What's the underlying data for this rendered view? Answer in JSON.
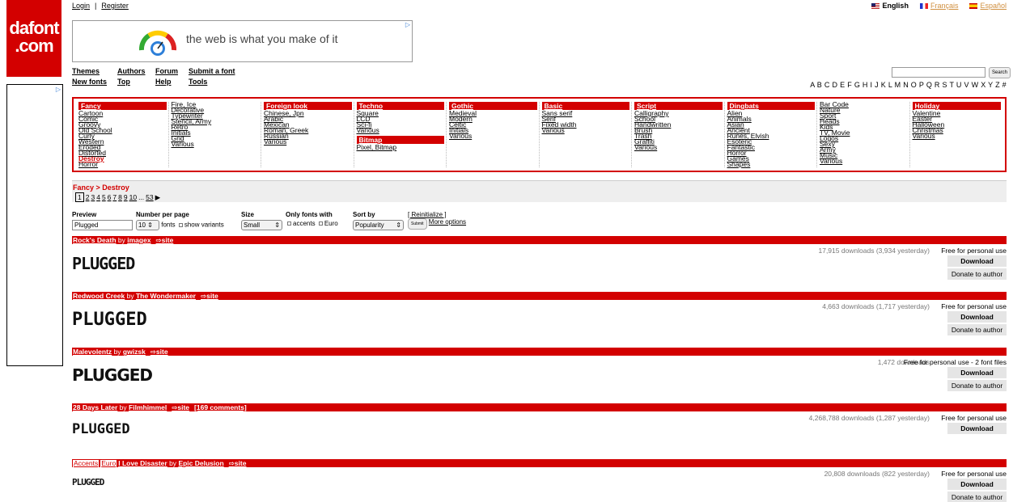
{
  "logo": {
    "line1": "dafont",
    "line2": ".com"
  },
  "top_links": {
    "login": "Login",
    "register": "Register"
  },
  "languages": {
    "english": "English",
    "french": "Français",
    "spanish": "Español"
  },
  "banner_ad": {
    "tagline": "the web is what you make of it"
  },
  "nav": {
    "themes": "Themes",
    "authors": "Authors",
    "forum": "Forum",
    "submit": "Submit a font",
    "new_fonts": "New fonts",
    "top": "Top",
    "help": "Help",
    "tools": "Tools"
  },
  "search": {
    "button": "Search",
    "value": ""
  },
  "alphabet": "A B C D E F G H I J K L M N O P Q R S T U V W X Y Z #",
  "categories": [
    {
      "head": "Fancy",
      "items": [
        "Cartoon",
        "Comic",
        "Groovy",
        "Old School",
        "Curly",
        "Western",
        "Eroded",
        "Distorted",
        "Destroy",
        "Horror"
      ],
      "active": "Destroy"
    },
    {
      "head": "",
      "items": [
        "Fire, Ice",
        "Decorative",
        "Typewriter",
        "Stencil, Army",
        "Retro",
        "Initials",
        "Grid",
        "Various"
      ]
    },
    {
      "head": "Foreign look",
      "items": [
        "Chinese, Jpn",
        "Arabic",
        "Mexican",
        "Roman, Greek",
        "Russian",
        "Various"
      ]
    },
    {
      "head": "Techno",
      "items": [
        "Square",
        "LCD",
        "Sci-fi",
        "Various"
      ],
      "head2": "Bitmap",
      "items2": [
        "Pixel, Bitmap"
      ]
    },
    {
      "head": "Gothic",
      "items": [
        "Medieval",
        "Modern",
        "Celtic",
        "Initials",
        "Various"
      ]
    },
    {
      "head": "Basic",
      "items": [
        "Sans serif",
        "Serif",
        "Fixed width",
        "Various"
      ]
    },
    {
      "head": "Script",
      "items": [
        "Calligraphy",
        "School",
        "Handwritten",
        "Brush",
        "Trash",
        "Graffiti",
        "Various"
      ]
    },
    {
      "head": "Dingbats",
      "items": [
        "Alien",
        "Animals",
        "Asian",
        "Ancient",
        "Runes, Elvish",
        "Esoteric",
        "Fantastic",
        "Horror",
        "Games",
        "Shapes"
      ]
    },
    {
      "head": "",
      "items": [
        "Bar Code",
        "Nature",
        "Sport",
        "Heads",
        "Kids",
        "TV, Movie",
        "Logos",
        "Sexy",
        "Army",
        "Music",
        "Various"
      ]
    },
    {
      "head": "Holiday",
      "items": [
        "Valentine",
        "Easter",
        "Halloween",
        "Christmas",
        "Various"
      ]
    }
  ],
  "breadcrumb": "Fancy > Destroy",
  "pagination": {
    "current": "1",
    "pages": [
      "2",
      "3",
      "4",
      "5",
      "6",
      "7",
      "8",
      "9",
      "10"
    ],
    "ellipsis": "...",
    "last": "53",
    "next": "▶"
  },
  "options": {
    "preview_label": "Preview",
    "preview_value": "Plugged",
    "number_label": "Number per page",
    "number_value": "10",
    "fonts_text": "fonts",
    "show_variants": "show variants",
    "size_label": "Size",
    "size_value": "Small",
    "only_label": "Only fonts with",
    "accents": "accents",
    "euro": "Euro",
    "sort_label": "Sort by",
    "sort_value": "Popularity",
    "reinit": "[ Reinitialize ]",
    "submit": "Submit",
    "more": "More options"
  },
  "fonts": [
    {
      "name": "Rock's Death",
      "by": "by",
      "author": "imagex",
      "site": "site",
      "comments": "",
      "tags": [],
      "preview": "PLUGGED",
      "stats": "17,915 downloads (3,934 yesterday)",
      "license": "Free for personal use",
      "download": "Download",
      "donate": "Donate to author"
    },
    {
      "name": "Redwood Creek",
      "by": "by",
      "author": "The Wondermaker",
      "site": "site",
      "comments": "",
      "tags": [],
      "preview": "PLUGGED",
      "stats": "4,663 downloads (1,717 yesterday)",
      "license": "Free for personal use",
      "download": "Download",
      "donate": "Donate to author"
    },
    {
      "name": "Malevolentz",
      "by": "by",
      "author": "gwizsk",
      "site": "site",
      "comments": "",
      "tags": [],
      "preview": "PLUGGED",
      "stats": "1,472 downloads",
      "license": "Free for personal use - 2 font files",
      "download": "Download",
      "donate": "Donate to author"
    },
    {
      "name": "28 Days Later",
      "by": "by",
      "author": "Filmhimmel",
      "site": "site",
      "comments": "[169 comments]",
      "tags": [],
      "preview": "PLUGGED",
      "stats": "4,268,788 downloads (1,287 yesterday)",
      "license": "Free for personal use",
      "download": "Download",
      "donate": ""
    },
    {
      "name": "I Love Disaster",
      "by": "by",
      "author": "Epic Delusion",
      "site": "site",
      "comments": "",
      "tags": [
        "Accents",
        "Euro"
      ],
      "preview": "PLUGGED",
      "stats": "20,808 downloads (822 yesterday)",
      "license": "Free for personal use",
      "download": "Download",
      "donate": "Donate to author"
    }
  ],
  "colors": {
    "brand": "#d30000",
    "button_bg": "#e5e5e5",
    "muted": "#777777"
  }
}
